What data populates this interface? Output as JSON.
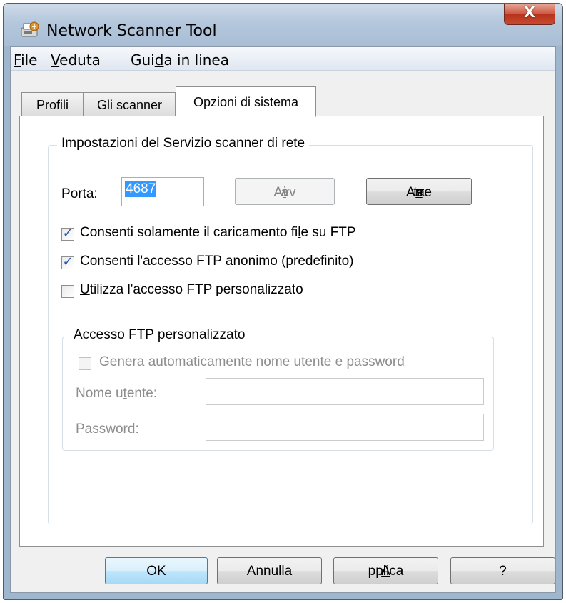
{
  "window": {
    "title": "Network Scanner Tool",
    "close_glyph": "X"
  },
  "menu": [
    {
      "pre": "",
      "ul": "F",
      "post": "ile"
    },
    {
      "pre": "",
      "ul": "V",
      "post": "eduta"
    },
    {
      "pre": "Gui",
      "ul": "d",
      "post": "a in linea"
    }
  ],
  "tabs": [
    {
      "label": "Profili",
      "active": false
    },
    {
      "label": "Gli scanner",
      "active": false
    },
    {
      "label": "Opzioni di sistema",
      "active": true
    }
  ],
  "service_group": {
    "title": "Impostazioni del Servizio scanner di rete",
    "port_label": {
      "pre": "",
      "ul": "P",
      "post": "orta:"
    },
    "port_value": "4687",
    "start_button": {
      "pre": "Avv",
      "ul": "i",
      "post": "a",
      "enabled": false
    },
    "stop_button": {
      "pre": "Arre",
      "ul": "s",
      "post": "ta",
      "enabled": true
    },
    "checkboxes": [
      {
        "pre": "Consenti solamente il caricamento fi",
        "ul": "l",
        "post": "e su FTP",
        "checked": true
      },
      {
        "pre": "Consenti l'accesso FTP ano",
        "ul": "n",
        "post": "imo (predefinito)",
        "checked": true
      },
      {
        "pre": "",
        "ul": "U",
        "post": "tilizza l'accesso FTP personalizzato",
        "checked": false
      }
    ]
  },
  "custom_ftp_group": {
    "title": "Accesso FTP personalizzato",
    "auto_generate": {
      "pre": "Genera automati",
      "ul": "c",
      "post": "amente nome utente e password",
      "checked": false,
      "enabled": false
    },
    "username_label": {
      "pre": "Nome u",
      "ul": "t",
      "post": "ente:"
    },
    "username_value": "",
    "password_label": {
      "pre": "Pass",
      "ul": "w",
      "post": "ord:"
    },
    "password_value": ""
  },
  "footer_buttons": {
    "ok": "OK",
    "cancel": "Annulla",
    "apply": {
      "pre": "",
      "ul": "A",
      "post": "pplica"
    },
    "help": "?"
  },
  "colors": {
    "selection": "#3399ff",
    "default_button_border": "#3c7fb1",
    "close_button": "#c84a30"
  }
}
